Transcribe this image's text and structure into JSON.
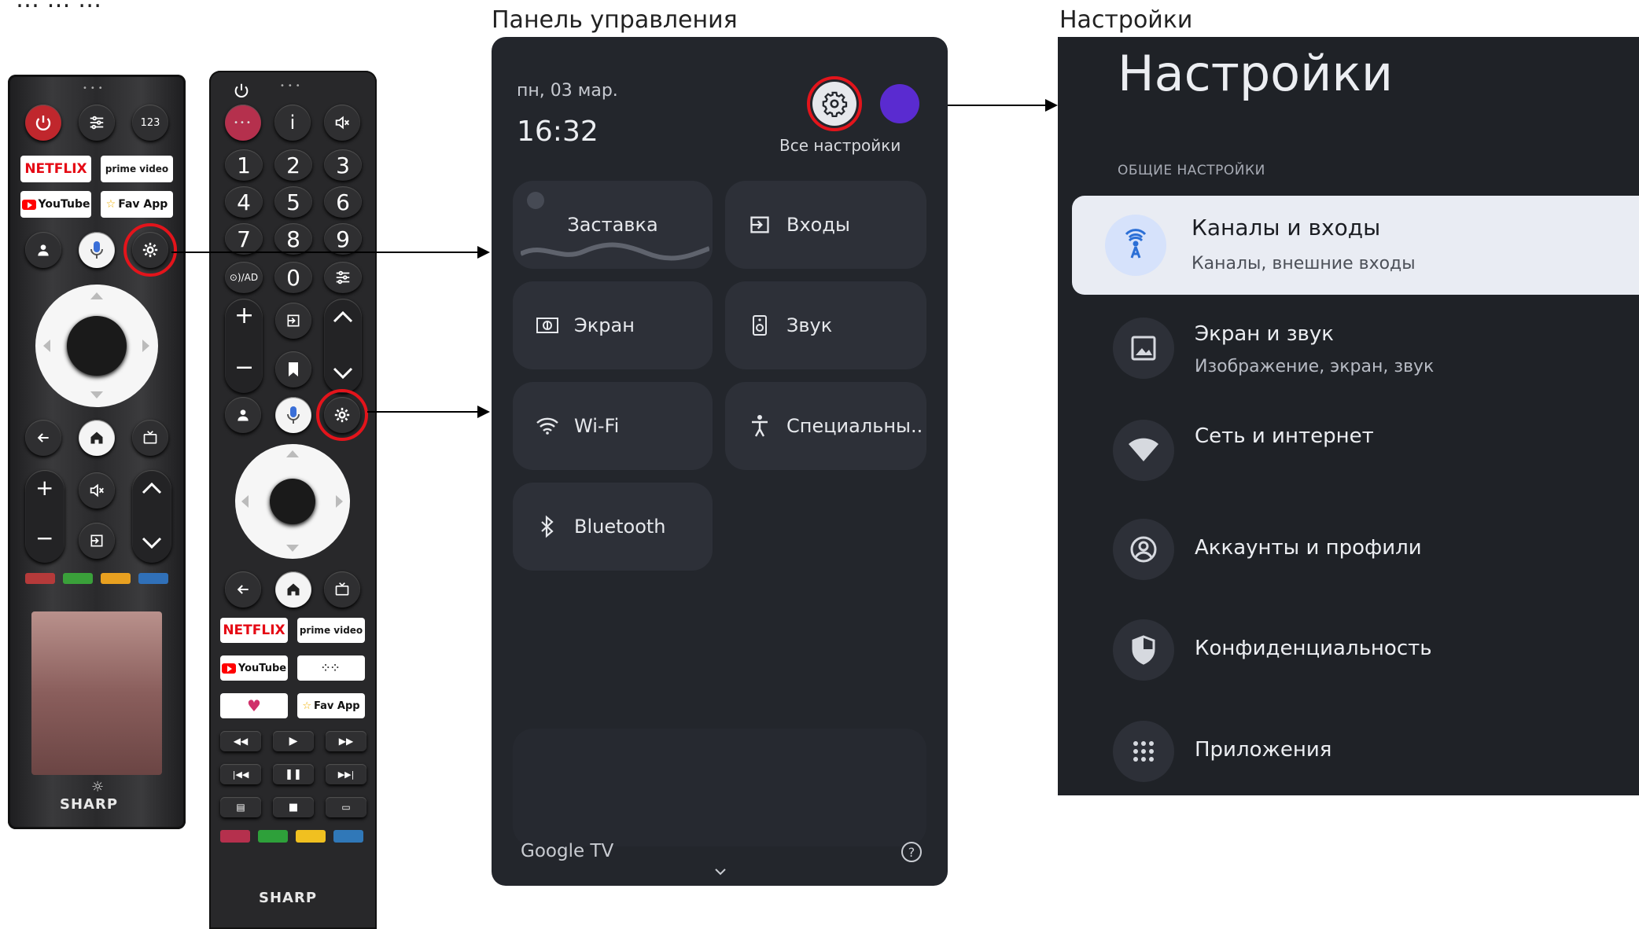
{
  "top_text": "… … …",
  "headings": {
    "control_panel": "Панель управления",
    "settings": "Настройки"
  },
  "remote_left": {
    "keys": {
      "num_label": "123",
      "netflix": "NETFLIX",
      "prime_line1": "prime video",
      "youtube": "YouTube",
      "favapp": "Fav App",
      "brand": "SHARP"
    },
    "color_keys": [
      "#b53a3a",
      "#3aa03a",
      "#e8a020",
      "#3070b8"
    ]
  },
  "remote_right": {
    "keys": {
      "info": "i",
      "n1": "1",
      "n2": "2",
      "n3": "3",
      "n4": "4",
      "n5": "5",
      "n6": "6",
      "n7": "7",
      "n8": "8",
      "n9": "9",
      "n0": "0",
      "ad": "⊙)/AD",
      "netflix": "NETFLIX",
      "prime_line1": "prime video",
      "youtube": "YouTube",
      "favapp": "Fav App",
      "brand": "SHARP"
    },
    "color_keys": [
      "#b5304d",
      "#2ea03a",
      "#f0c020",
      "#3078b8"
    ]
  },
  "control_panel": {
    "date": "пн, 03 мар.",
    "time": "16:32",
    "all_settings": "Все настройки",
    "avatar_color": "#5a2bd0",
    "tiles": {
      "screensaver": "Заставка",
      "inputs": "Входы",
      "screen": "Экран",
      "sound": "Звук",
      "wifi": "Wi-Fi",
      "accessibility": "Специальны..",
      "bluetooth": "Bluetooth"
    },
    "footer_brand": "Google TV",
    "help": "?"
  },
  "settings": {
    "title": "Настройки",
    "section": "ОБЩИЕ НАСТРОЙКИ",
    "items": [
      {
        "title": "Каналы и входы",
        "subtitle": "Каналы, внешние входы",
        "icon": "antenna-icon",
        "selected": true
      },
      {
        "title": "Экран и звук",
        "subtitle": "Изображение, экран, звук",
        "icon": "image-icon"
      },
      {
        "title": "Сеть и интернет",
        "subtitle": "",
        "icon": "wifi-icon"
      },
      {
        "title": "Аккаунты и профили",
        "subtitle": "",
        "icon": "account-icon"
      },
      {
        "title": "Конфиденциальность",
        "subtitle": "",
        "icon": "shield-icon"
      },
      {
        "title": "Приложения",
        "subtitle": "",
        "icon": "apps-icon"
      }
    ]
  },
  "highlight_color": "#e3141b"
}
